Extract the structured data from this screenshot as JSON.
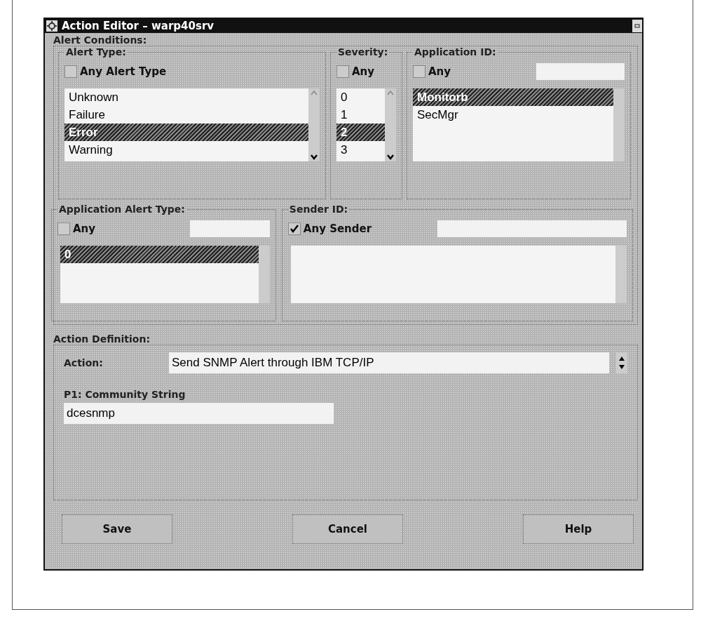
{
  "window": {
    "title": "Action Editor – warp40srv"
  },
  "alert_conditions": {
    "label": "Alert Conditions:",
    "alert_type": {
      "label": "Alert Type:",
      "any": {
        "label": "Any Alert Type",
        "checked": false
      },
      "items": [
        {
          "label": "Unknown",
          "selected": false
        },
        {
          "label": "Failure",
          "selected": false
        },
        {
          "label": "Error",
          "selected": true
        },
        {
          "label": "Warning",
          "selected": false
        }
      ]
    },
    "severity": {
      "label": "Severity:",
      "any": {
        "label": "Any",
        "checked": false
      },
      "items": [
        {
          "label": "0",
          "selected": false
        },
        {
          "label": "1",
          "selected": false
        },
        {
          "label": "2",
          "selected": true
        },
        {
          "label": "3",
          "selected": false
        }
      ]
    },
    "application_id": {
      "label": "Application ID:",
      "any": {
        "label": "Any",
        "checked": false
      },
      "items": [
        {
          "label": "Monitorb",
          "selected": true
        },
        {
          "label": "SecMgr",
          "selected": false
        }
      ]
    },
    "application_alert_type": {
      "label": "Application Alert Type:",
      "any": {
        "label": "Any",
        "checked": false
      },
      "items": [
        {
          "label": "0",
          "selected": true
        }
      ]
    },
    "sender_id": {
      "label": "Sender ID:",
      "any": {
        "label": "Any Sender",
        "checked": true
      }
    }
  },
  "action_definition": {
    "label": "Action Definition:",
    "action": {
      "label": "Action:",
      "value": "Send SNMP Alert through IBM TCP/IP"
    },
    "parameter": {
      "label": "P1: Community String",
      "value": "dcesnmp"
    }
  },
  "buttons": [
    "Save",
    "Cancel",
    "Help"
  ]
}
